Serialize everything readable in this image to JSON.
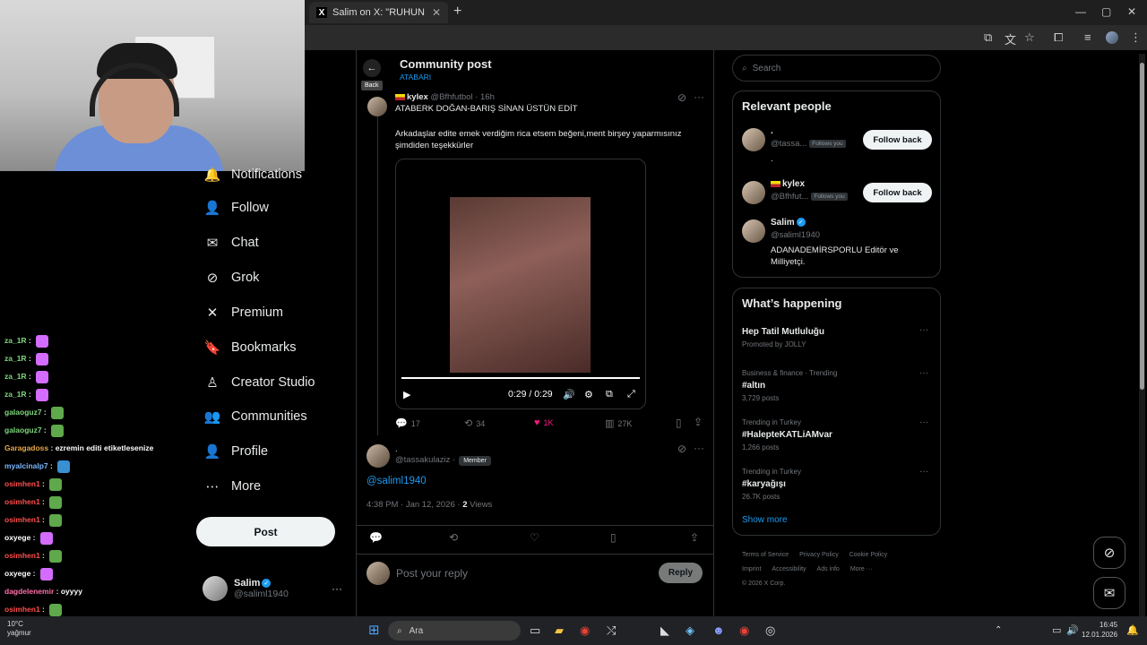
{
  "browser": {
    "tab_title": "Salim on X: \"RUHUN ŞAD OLSU",
    "tab_close": "✕",
    "new_tab": "+",
    "minimize": "—",
    "restore": "▢",
    "close": "✕"
  },
  "chat": {
    "lines": [
      {
        "user": "za_1R",
        "msg": "",
        "color": "#7cd67c",
        "emote": "#d46cff"
      },
      {
        "user": "za_1R",
        "msg": "",
        "color": "#7cd67c",
        "emote": "#d46cff"
      },
      {
        "user": "za_1R",
        "msg": "",
        "color": "#7cd67c",
        "emote": "#d46cff"
      },
      {
        "user": "za_1R",
        "msg": "",
        "color": "#7cd67c",
        "emote": "#d46cff"
      },
      {
        "user": "galaoguz7",
        "msg": "",
        "color": "#7cd67c",
        "emote": "#5fa84b"
      },
      {
        "user": "galaoguz7",
        "msg": "",
        "color": "#7cd67c",
        "emote": "#5fa84b"
      },
      {
        "user": "Garagadoss",
        "msg": "ezremin editi etiketlesenize",
        "color": "#e6a84b",
        "emote": ""
      },
      {
        "user": "myalcinalp7",
        "msg": "",
        "color": "#7ab8ff",
        "emote": "#3a8fd0"
      },
      {
        "user": "osimhen1",
        "msg": "",
        "color": "#ff4d4d",
        "emote": "#5fa84b"
      },
      {
        "user": "osimhen1",
        "msg": "",
        "color": "#ff4d4d",
        "emote": "#5fa84b"
      },
      {
        "user": "osimhen1",
        "msg": "",
        "color": "#ff4d4d",
        "emote": "#5fa84b"
      },
      {
        "user": "oxyege",
        "msg": "",
        "color": "#ffffff",
        "emote": "#d46cff"
      },
      {
        "user": "osimhen1",
        "msg": "",
        "color": "#ff4d4d",
        "emote": "#5fa84b"
      },
      {
        "user": "oxyege",
        "msg": "",
        "color": "#ffffff",
        "emote": "#d46cff"
      },
      {
        "user": "dagdelenemir",
        "msg": "oyyyy",
        "color": "#ff6fa8",
        "emote": ""
      },
      {
        "user": "osimhen1",
        "msg": "",
        "color": "#ff4d4d",
        "emote": "#5fa84b"
      }
    ]
  },
  "nav": {
    "items": [
      {
        "label": "Notifications",
        "icon": "🔔",
        "name": "notifications"
      },
      {
        "label": "Follow",
        "icon": "👤",
        "name": "follow"
      },
      {
        "label": "Chat",
        "icon": "✉",
        "name": "chat"
      },
      {
        "label": "Grok",
        "icon": "⊘",
        "name": "grok"
      },
      {
        "label": "Premium",
        "icon": "✕",
        "name": "premium"
      },
      {
        "label": "Bookmarks",
        "icon": "🔖",
        "name": "bookmarks"
      },
      {
        "label": "Creator Studio",
        "icon": "♙",
        "name": "creator-studio"
      },
      {
        "label": "Communities",
        "icon": "👥",
        "name": "communities"
      },
      {
        "label": "Profile",
        "icon": "👤",
        "name": "profile"
      },
      {
        "label": "More",
        "icon": "⋯",
        "name": "more"
      }
    ],
    "post_label": "Post",
    "account_name": "Salim",
    "account_handle": "@saliml1940",
    "account_more": "···"
  },
  "main": {
    "back_label": "Back",
    "back_icon": "←",
    "title": "Community post",
    "subtitle": "ATABARI",
    "post1": {
      "name": "kylex",
      "handle": "@Bfhfutbol",
      "time": "· 16h",
      "title": "ATABERK DOĞAN-BARIŞ SİNAN ÜSTÜN EDİT",
      "body": "Arkadaşlar edite emek verdiğim rica etsem beğeni,ment birşey yaparmısınız şimdiden teşekkürler",
      "video_time": "0:29 / 0:29",
      "replies": "17",
      "reposts": "34",
      "likes": "1K",
      "views": "27K"
    },
    "post2": {
      "name": ".",
      "handle": "@tassakulaziz ·",
      "badge": "Member",
      "mention": "@saliml1940",
      "meta_time": "4:38 PM · Jan 12, 2026 ·",
      "meta_views_count": "2",
      "meta_views_label": "Views"
    },
    "reply_placeholder": "Post your reply",
    "reply_button": "Reply"
  },
  "right": {
    "search_placeholder": "Search",
    "relevant_title": "Relevant people",
    "people": [
      {
        "name": ".",
        "handle": "@tassa...",
        "follows_you": "Follows you",
        "bio": ".",
        "button": "Follow back"
      },
      {
        "name": "kylex",
        "handle": "@Bfhfut...",
        "follows_you": "Follows you",
        "bio": "",
        "button": "Follow back"
      },
      {
        "name": "Salim",
        "handle": "@saliml1940",
        "follows_you": "",
        "bio": "ADANADEMİRSPORLU Editör ve Milliyetçi.",
        "button": ""
      }
    ],
    "happening_title": "What’s happening",
    "trends": [
      {
        "meta": "",
        "name": "Hep Tatil Mutluluğu",
        "count": "Promoted by JOLLY"
      },
      {
        "meta": "Business & finance · Trending",
        "name": "#altın",
        "count": "3,729 posts"
      },
      {
        "meta": "Trending in Turkey",
        "name": "#HalepteKATLiAMvar",
        "count": "1,266 posts"
      },
      {
        "meta": "Trending in Turkey",
        "name": "#karyağışı",
        "count": "26.7K posts"
      }
    ],
    "show_more": "Show more",
    "footer": [
      "Terms of Service",
      "Privacy Policy",
      "Cookie Policy",
      "Imprint",
      "Accessibility",
      "Ads info",
      "More ···",
      "© 2026 X Corp."
    ]
  },
  "taskbar": {
    "search_label": "Ara",
    "time": "16:45",
    "date": "12.01.2026",
    "weather_temp": "10°C",
    "weather_desc": "yağmur"
  },
  "colors": {
    "accent": "#1d9bf0",
    "like": "#f91880",
    "bg": "#000000"
  }
}
